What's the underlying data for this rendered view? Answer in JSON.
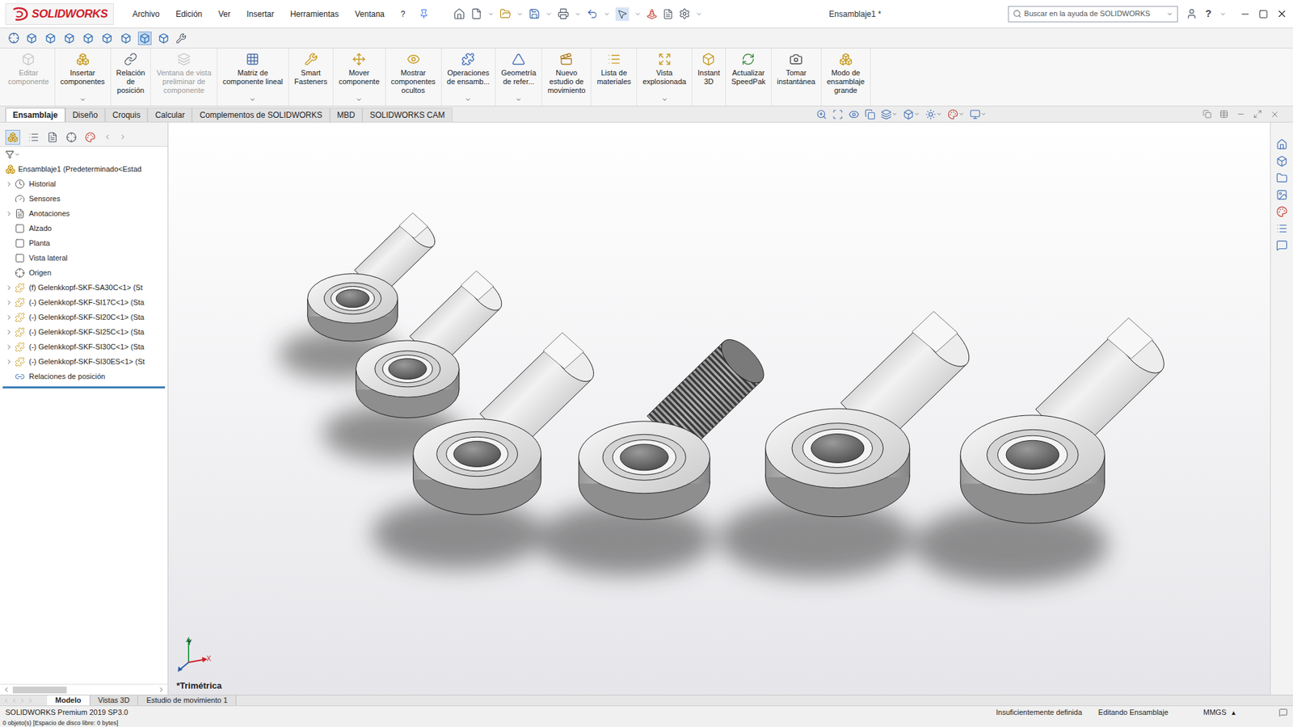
{
  "app": {
    "logo": "SOLIDWORKS",
    "title": "Ensamblaje1 *",
    "search_placeholder": "Buscar en la ayuda de SOLIDWORKS",
    "help": "?"
  },
  "menu": [
    "Archivo",
    "Edición",
    "Ver",
    "Insertar",
    "Herramientas",
    "Ventana",
    "?"
  ],
  "ribbon": [
    {
      "label": "Editar\ncomponente",
      "disabled": true,
      "dropdown": false
    },
    {
      "label": "Insertar\ncomponentes",
      "disabled": false,
      "dropdown": true
    },
    {
      "label": "Relación\nde\nposición",
      "disabled": false,
      "dropdown": false
    },
    {
      "label": "Ventana de vista\npreliminar de\ncomponente",
      "disabled": true,
      "dropdown": false
    },
    {
      "label": "Matriz de\ncomponente lineal",
      "disabled": false,
      "dropdown": true
    },
    {
      "label": "Smart\nFasteners",
      "disabled": false,
      "dropdown": false
    },
    {
      "label": "Mover\ncomponente",
      "disabled": false,
      "dropdown": true
    },
    {
      "label": "Mostrar\ncomponentes\nocultos",
      "disabled": false,
      "dropdown": false
    },
    {
      "label": "Operaciones\nde ensamb...",
      "disabled": false,
      "dropdown": true
    },
    {
      "label": "Geometría\nde refer...",
      "disabled": false,
      "dropdown": true
    },
    {
      "label": "Nuevo\nestudio de\nmovimiento",
      "disabled": false,
      "dropdown": false
    },
    {
      "label": "Lista de\nmateriales",
      "disabled": false,
      "dropdown": false
    },
    {
      "label": "Vista\nexplosionada",
      "disabled": false,
      "dropdown": true
    },
    {
      "label": "Instant\n3D",
      "disabled": false,
      "dropdown": false
    },
    {
      "label": "Actualizar\nSpeedPak",
      "disabled": false,
      "dropdown": false
    },
    {
      "label": "Tomar\ninstantánea",
      "disabled": false,
      "dropdown": false
    },
    {
      "label": "Modo de\nensamblaje\ngrande",
      "disabled": false,
      "dropdown": false
    }
  ],
  "tabs": [
    {
      "label": "Ensamblaje",
      "selected": true
    },
    {
      "label": "Diseño",
      "selected": false
    },
    {
      "label": "Croquis",
      "selected": false
    },
    {
      "label": "Calcular",
      "selected": false
    },
    {
      "label": "Complementos de SOLIDWORKS",
      "selected": false
    },
    {
      "label": "MBD",
      "selected": false
    },
    {
      "label": "SOLIDWORKS CAM",
      "selected": false
    }
  ],
  "tree": {
    "root": "Ensamblaje1  (Predeterminado<Estad",
    "items": [
      {
        "label": "Historial",
        "kind": "history",
        "expandable": true
      },
      {
        "label": "Sensores",
        "kind": "sensors",
        "expandable": false
      },
      {
        "label": "Anotaciones",
        "kind": "annotations",
        "expandable": true
      },
      {
        "label": "Alzado",
        "kind": "plane",
        "expandable": false
      },
      {
        "label": "Planta",
        "kind": "plane",
        "expandable": false
      },
      {
        "label": "Vista lateral",
        "kind": "plane",
        "expandable": false
      },
      {
        "label": "Origen",
        "kind": "origin",
        "expandable": false
      },
      {
        "label": "(f) Gelenkkopf-SKF-SA30C<1> (St",
        "kind": "component",
        "expandable": true
      },
      {
        "label": "(-) Gelenkkopf-SKF-SI17C<1> (Sta",
        "kind": "component",
        "expandable": true
      },
      {
        "label": "(-) Gelenkkopf-SKF-SI20C<1> (Sta",
        "kind": "component",
        "expandable": true
      },
      {
        "label": "(-) Gelenkkopf-SKF-SI25C<1> (Sta",
        "kind": "component",
        "expandable": true
      },
      {
        "label": "(-) Gelenkkopf-SKF-SI30C<1> (Sta",
        "kind": "component",
        "expandable": true
      },
      {
        "label": "(-) Gelenkkopf-SKF-SI30ES<1> (St",
        "kind": "component",
        "expandable": true
      },
      {
        "label": "Relaciones de posición",
        "kind": "mates",
        "expandable": false
      }
    ]
  },
  "viewport": {
    "view_label": "*Trimétrica",
    "triad": {
      "y": "Y",
      "x": "X"
    },
    "parts": [
      {
        "kind": "plain"
      },
      {
        "kind": "plain"
      },
      {
        "kind": "plain"
      },
      {
        "kind": "threaded"
      },
      {
        "kind": "plain"
      },
      {
        "kind": "plain"
      }
    ]
  },
  "bottom_tabs": [
    {
      "label": "Modelo",
      "selected": true
    },
    {
      "label": "Vistas 3D",
      "selected": false
    },
    {
      "label": "Estudio de movimiento 1",
      "selected": false
    }
  ],
  "status": {
    "product": "SOLIDWORKS Premium 2019 SP3.0",
    "definition": "Insuficientemente definida",
    "mode": "Editando Ensamblaje",
    "units": "MMGS",
    "units_arrow": "▴"
  },
  "footer_note": "0 objeto(s) [Espacio de disco libre: 0 bytes]"
}
